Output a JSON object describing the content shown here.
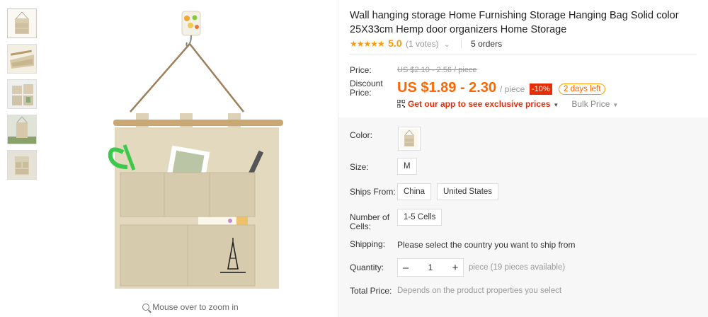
{
  "gallery": {
    "zoom_hint": "Mouse over to zoom in",
    "thumbnails": [
      "thumb-1",
      "thumb-2",
      "thumb-3",
      "thumb-4",
      "thumb-5"
    ]
  },
  "product": {
    "title": "Wall hanging storage Home Furnishing Storage Hanging Bag Solid color 25X33cm Hemp door organizers Home Storage",
    "stars": "★★★★★",
    "rating": "5.0",
    "votes": "(1 votes)",
    "orders": "5 orders"
  },
  "pricing": {
    "price_label": "Price:",
    "original_price": "US $2.10 - 2.56 / piece",
    "discount_label": "Discount Price:",
    "discount_price": "US $1.89 - 2.30",
    "unit": "/ piece",
    "discount_badge": "-10%",
    "days_left": "2 days left",
    "app_promo": "Get our app to see exclusive prices",
    "bulk_price": "Bulk Price"
  },
  "options": {
    "color_label": "Color:",
    "size_label": "Size:",
    "size_value": "M",
    "ships_from_label": "Ships From:",
    "ships_from_options": [
      "China",
      "United States"
    ],
    "cells_label": "Number of Cells:",
    "cells_value": "1-5 Cells",
    "shipping_label": "Shipping:",
    "shipping_text": "Please select the country you want to ship from",
    "quantity_label": "Quantity:",
    "quantity_value": "1",
    "quantity_note": "piece (19 pieces available)",
    "total_label": "Total Price:",
    "total_text": "Depends on the product properties you select"
  },
  "colors": {
    "accent": "#ff6600",
    "discount_red": "#e62e04",
    "star": "#ff9900"
  }
}
